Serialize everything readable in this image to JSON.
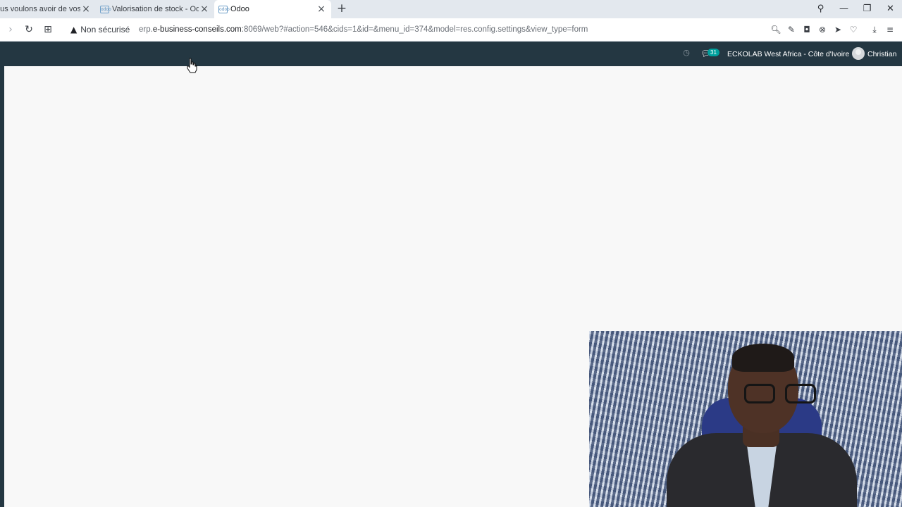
{
  "browser": {
    "tabs": [
      {
        "title": "ous voulons avoir de vos",
        "active": false
      },
      {
        "title": "Valorisation de stock - Odo",
        "active": false
      },
      {
        "title": "Odoo",
        "active": true
      }
    ],
    "favicon_text": "odoo",
    "new_tab_label": "+",
    "security_label": "Non sécurisé",
    "url_prefix": "erp.",
    "url_host": "e-business-conseils.com",
    "url_rest": ":8069/web?#action=546&cids=1&id=&menu_id=374&model=res.config.settings&view_type=form"
  },
  "odoo": {
    "chat_count": "31",
    "company": "ECKOLAB West Africa - Côte d'Ivoire",
    "user": "Christian"
  },
  "colors": {
    "navbar": "#243742",
    "content_bg": "#f8f8f8",
    "badge": "#00a09d"
  },
  "icons": {
    "back": "chevron-right-icon",
    "reload": "reload-icon",
    "tabs_grid": "grid-icon",
    "warning": "warning-triangle-icon"
  }
}
